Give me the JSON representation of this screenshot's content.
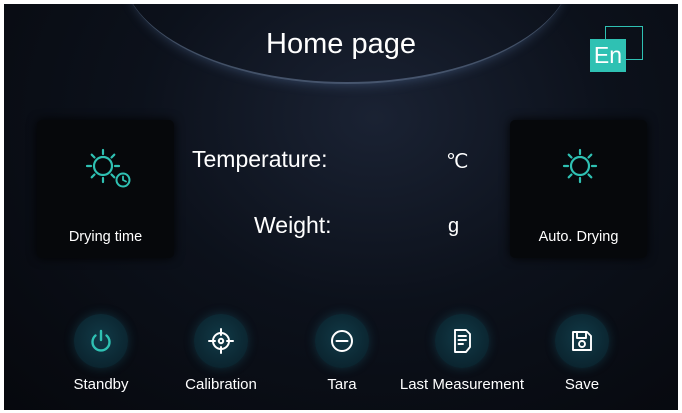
{
  "header": {
    "title": "Home page",
    "language_label": "En"
  },
  "tiles": {
    "drying_time": {
      "label": "Drying time",
      "icon": "sun-clock-icon"
    },
    "auto_drying": {
      "label": "Auto. Drying",
      "icon": "sun-icon"
    }
  },
  "readouts": {
    "temperature": {
      "label": "Temperature:",
      "unit": "℃"
    },
    "weight": {
      "label": "Weight:",
      "unit": "g"
    }
  },
  "actions": [
    {
      "label": "Standby",
      "icon": "power-icon"
    },
    {
      "label": "Calibration",
      "icon": "crosshair-icon"
    },
    {
      "label": "Tara",
      "icon": "minus-circle-icon"
    },
    {
      "label": "Last Measurement",
      "icon": "document-icon"
    },
    {
      "label": "Save",
      "icon": "floppy-disk-icon"
    }
  ],
  "colors": {
    "accent": "#2fc1b3",
    "background": "#0b0f17",
    "tile": "#06080b"
  }
}
